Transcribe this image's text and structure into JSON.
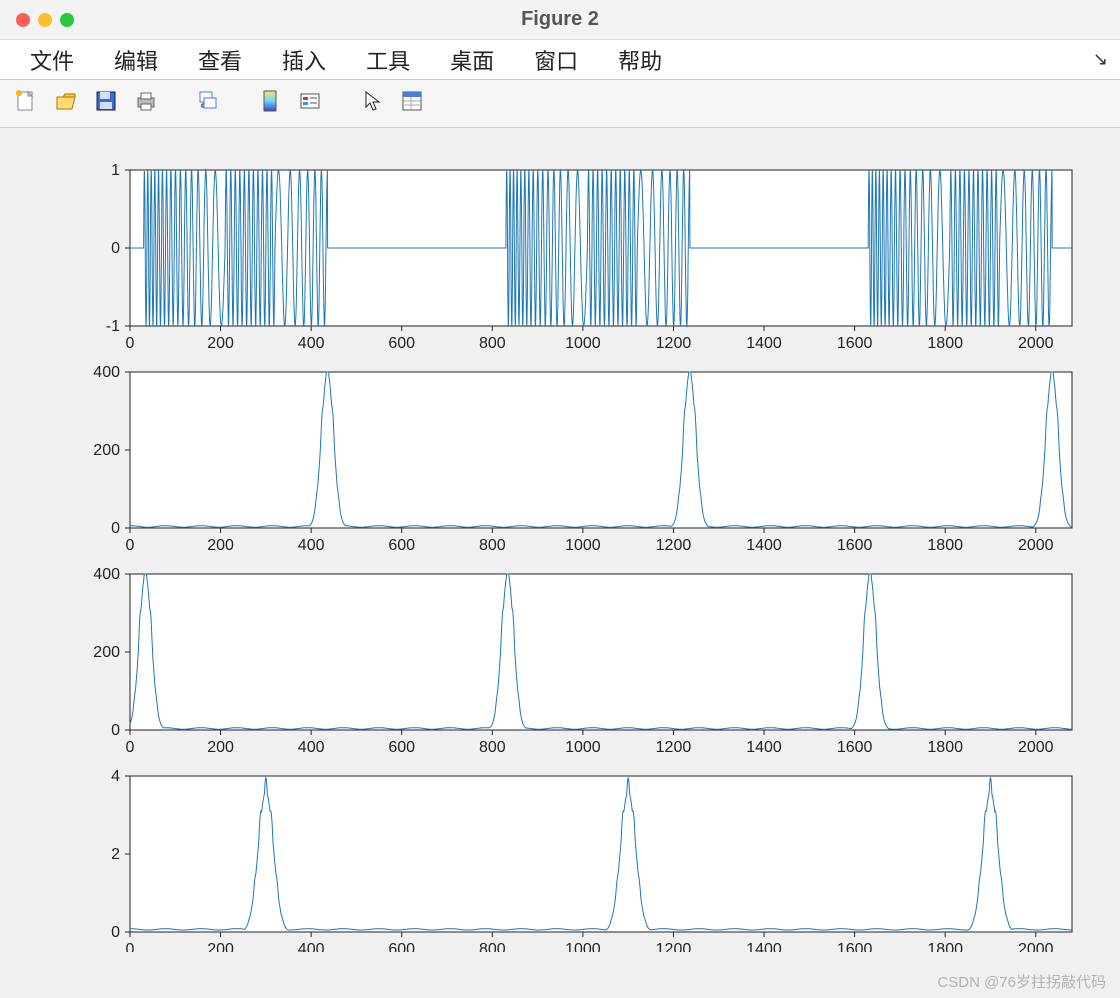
{
  "window": {
    "title": "Figure 2"
  },
  "menu": {
    "items": [
      "文件",
      "编辑",
      "查看",
      "插入",
      "工具",
      "桌面",
      "窗口",
      "帮助"
    ]
  },
  "toolbar": {
    "icons": [
      "new-file-icon",
      "open-file-icon",
      "save-icon",
      "print-icon",
      "docked-icon",
      "colormap-icon",
      "legend-icon",
      "pointer-icon",
      "properties-icon"
    ]
  },
  "watermark": "CSDN @76岁拄拐敲代码",
  "chart_data": [
    {
      "type": "line",
      "title": "",
      "xlabel": "",
      "ylabel": "",
      "xlim": [
        0,
        2080
      ],
      "ylim": [
        -1,
        1
      ],
      "xticks": [
        0,
        200,
        400,
        600,
        800,
        1000,
        1200,
        1400,
        1600,
        1800,
        2000
      ],
      "yticks": [
        -1,
        0,
        1
      ],
      "series": [
        {
          "name": "signal",
          "kind": "stft-chirp-bursts",
          "bursts": [
            {
              "start": 30,
              "end": 436,
              "segments": [
                [
                  30,
                  210,
                  "chirp-down",
                  25,
                  5
                ],
                [
                  210,
                  320,
                  "sine",
                  11,
                  4
                ],
                [
                  320,
                  436,
                  "chirp-up",
                  3.5,
                  9
                ]
              ]
            },
            {
              "start": 830,
              "end": 1236,
              "segments": [
                [
                  830,
                  1010,
                  "chirp-down",
                  25,
                  5
                ],
                [
                  1010,
                  1120,
                  "sine",
                  11,
                  4
                ],
                [
                  1120,
                  1236,
                  "chirp-up",
                  3.5,
                  9
                ]
              ]
            },
            {
              "start": 1630,
              "end": 2036,
              "segments": [
                [
                  1630,
                  1810,
                  "chirp-down",
                  25,
                  5
                ],
                [
                  1810,
                  1920,
                  "sine",
                  11,
                  4
                ],
                [
                  1920,
                  2036,
                  "chirp-up",
                  3.5,
                  9
                ]
              ]
            }
          ],
          "baseline": 0
        }
      ]
    },
    {
      "type": "line",
      "title": "",
      "xlabel": "",
      "ylabel": "",
      "xlim": [
        0,
        2080
      ],
      "ylim": [
        0,
        400
      ],
      "xticks": [
        0,
        200,
        400,
        600,
        800,
        1000,
        1200,
        1400,
        1600,
        1800,
        2000
      ],
      "yticks": [
        0,
        200,
        400
      ],
      "series": [
        {
          "name": "spectrum-peaks",
          "kind": "peaks",
          "centers": [
            436,
            1236,
            2036
          ],
          "peak": 400,
          "base": 2,
          "width": 40,
          "offset": 0
        }
      ]
    },
    {
      "type": "line",
      "title": "",
      "xlabel": "",
      "ylabel": "",
      "xlim": [
        0,
        2080
      ],
      "ylim": [
        0,
        400
      ],
      "xticks": [
        0,
        200,
        400,
        600,
        800,
        1000,
        1200,
        1400,
        1600,
        1800,
        2000
      ],
      "yticks": [
        0,
        200,
        400
      ],
      "series": [
        {
          "name": "spectrum-peaks",
          "kind": "peaks",
          "centers": [
            34,
            834,
            1634
          ],
          "peak": 400,
          "base": 2,
          "width": 40,
          "offset": 0
        }
      ]
    },
    {
      "type": "line",
      "title": "",
      "xlabel": "",
      "ylabel": "",
      "xlim": [
        0,
        2080
      ],
      "ylim": [
        0,
        4
      ],
      "xticks": [
        0,
        200,
        400,
        600,
        800,
        1000,
        1200,
        1400,
        1600,
        1800,
        2000
      ],
      "yticks": [
        0,
        2,
        4
      ],
      "series": [
        {
          "name": "spectrum-peaks",
          "kind": "peaks",
          "centers": [
            300,
            1100,
            1900
          ],
          "peak": 3.6,
          "base": 0.05,
          "width": 50,
          "offset": 0
        }
      ]
    }
  ]
}
